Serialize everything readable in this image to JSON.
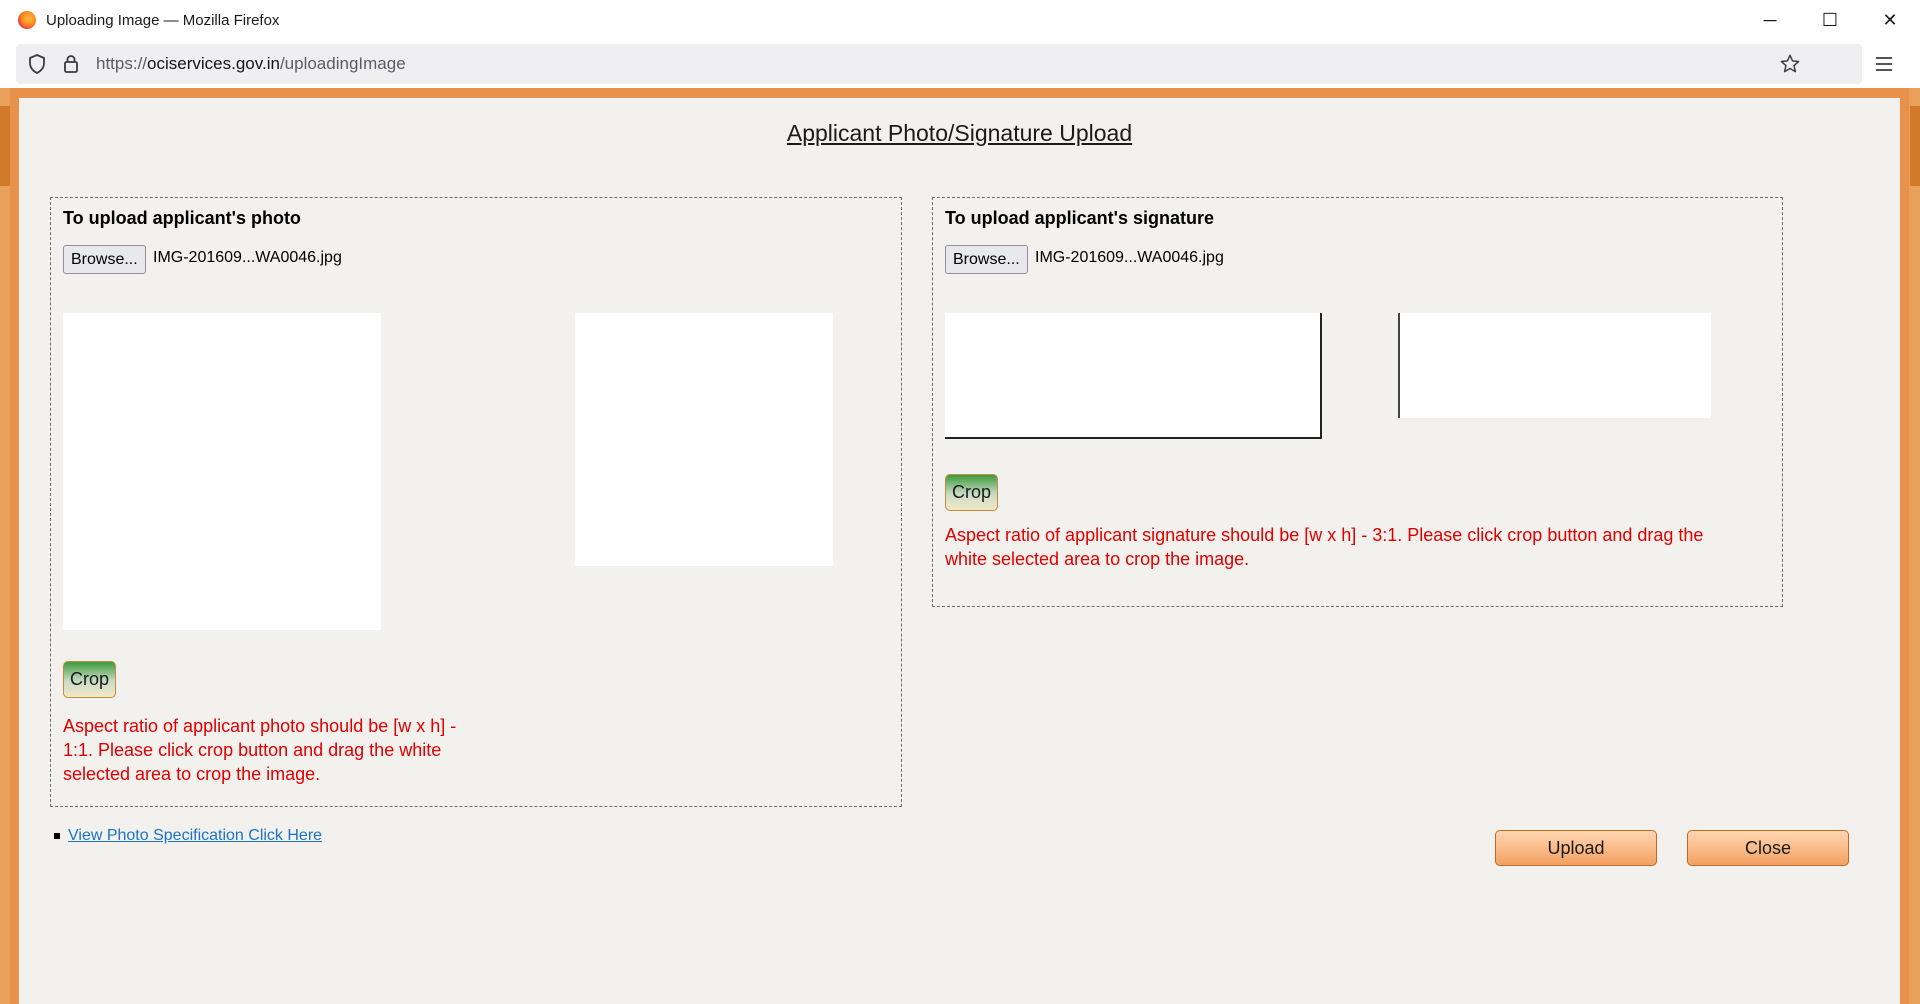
{
  "window": {
    "title": "Uploading Image — Mozilla Firefox",
    "controls": [
      "─",
      "☐",
      "✕"
    ]
  },
  "urlbar": {
    "scheme": "https://",
    "domain": "ociservices.gov.in",
    "path": "/uploadingImage"
  },
  "page": {
    "title": "Applicant Photo/Signature Upload",
    "photo_panel": {
      "heading": "To upload applicant's photo",
      "browse_label": "Browse...",
      "file_name": "IMG-201609...WA0046.jpg",
      "crop_label": "Crop",
      "hint": "Aspect ratio of applicant photo should be [w x h] - 1:1. Please click crop button and drag the white selected area to crop the image."
    },
    "signature_panel": {
      "heading": "To upload applicant's signature",
      "browse_label": "Browse...",
      "file_name": "IMG-201609...WA0046.jpg",
      "crop_label": "Crop",
      "hint": "Aspect ratio of applicant signature should be [w x h] - 3:1. Please click crop button and drag the white selected area to crop the image."
    },
    "spec_link": "View Photo Specification Click Here",
    "upload_label": "Upload",
    "close_label": "Close"
  },
  "colors": {
    "modal_border": "#e8914a",
    "hint_text": "#e00000",
    "link": "#1a73c8"
  }
}
